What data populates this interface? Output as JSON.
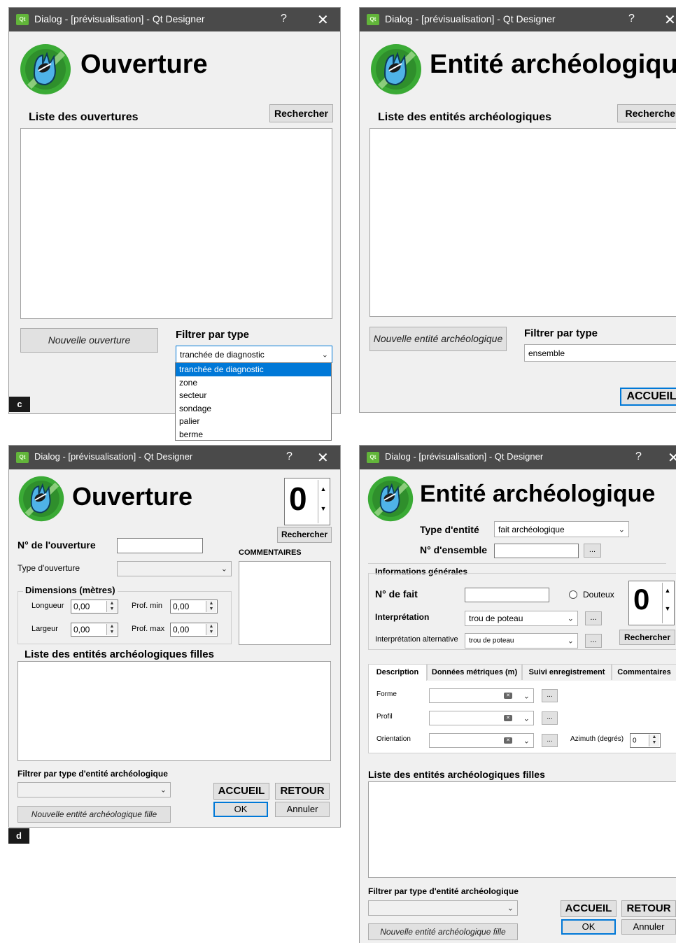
{
  "window_title": "Dialog - [prévisualisation] - Qt Designer",
  "titlebar_help": "?",
  "titlebar_close": "✕",
  "qt_icon": "Qt",
  "colors": {
    "titlebar": "#4a4a4a",
    "window": "#f0f0f0",
    "selection": "#0078d7",
    "logo_green": "#3aaa35"
  },
  "panel_c": {
    "title": "Ouverture",
    "list_label": "Liste des ouvertures",
    "search_button": "Rechercher",
    "new_button": "Nouvelle ouverture",
    "filter_label": "Filtrer par type",
    "filter_value": "tranchée de diagnostic",
    "dropdown_items": [
      "tranchée de diagnostic",
      "zone",
      "secteur",
      "sondage",
      "palier",
      "berme"
    ],
    "corner_label": "c"
  },
  "panel_c2": {
    "title": "Entité archéologique",
    "list_label": "Liste des entités archéologiques",
    "search_button": "Rechercher",
    "new_button": "Nouvelle entité archéologique",
    "filter_label": "Filtrer par type",
    "filter_value": "ensemble",
    "home_button": "ACCUEIL"
  },
  "panel_d": {
    "title": "Ouverture",
    "counter": "0",
    "search_button": "Rechercher",
    "number_label": "N° de l'ouverture",
    "type_label": "Type d'ouverture",
    "comments_label": "COMMENTAIRES",
    "dimensions_label": "Dimensions (mètres)",
    "length_label": "Longueur",
    "length_value": "0,00",
    "width_label": "Largeur",
    "width_value": "0,00",
    "depth_min_label": "Prof. min",
    "depth_min_value": "0,00",
    "depth_max_label": "Prof. max",
    "depth_max_value": "0,00",
    "children_label": "Liste des entités archéologiques filles",
    "filter_label": "Filtrer par type d'entité archéologique",
    "home_button": "ACCUEIL",
    "back_button": "RETOUR",
    "ok_button": "OK",
    "cancel_button": "Annuler",
    "new_child_button": "Nouvelle entité archéologique fille",
    "corner_label": "d"
  },
  "panel_d2": {
    "title": "Entité archéologique",
    "entity_type_label": "Type d'entité",
    "entity_type_value": "fait archéologique",
    "ensemble_label": "N° d'ensemble",
    "ellipsis": "...",
    "general_info_label": "Informations générales",
    "fact_number_label": "N° de fait",
    "doubtful_label": "Douteux",
    "counter": "0",
    "search_button": "Rechercher",
    "interpretation_label": "Interprétation",
    "interpretation_value": "trou de poteau",
    "alt_interpretation_label": "Interprétation alternative",
    "alt_interpretation_value": "trou de poteau",
    "tabs": [
      "Description",
      "Données métriques (m)",
      "Suivi enregistrement",
      "Commentaires"
    ],
    "shape_label": "Forme",
    "profile_label": "Profil",
    "orientation_label": "Orientation",
    "azimuth_label": "Azimuth (degrés)",
    "azimuth_value": "0",
    "children_label": "Liste des entités archéologiques filles",
    "filter_label": "Filtrer par type d'entité archéologique",
    "home_button": "ACCUEIL",
    "back_button": "RETOUR",
    "ok_button": "OK",
    "cancel_button": "Annuler",
    "new_child_button": "Nouvelle entité archéologique fille"
  }
}
